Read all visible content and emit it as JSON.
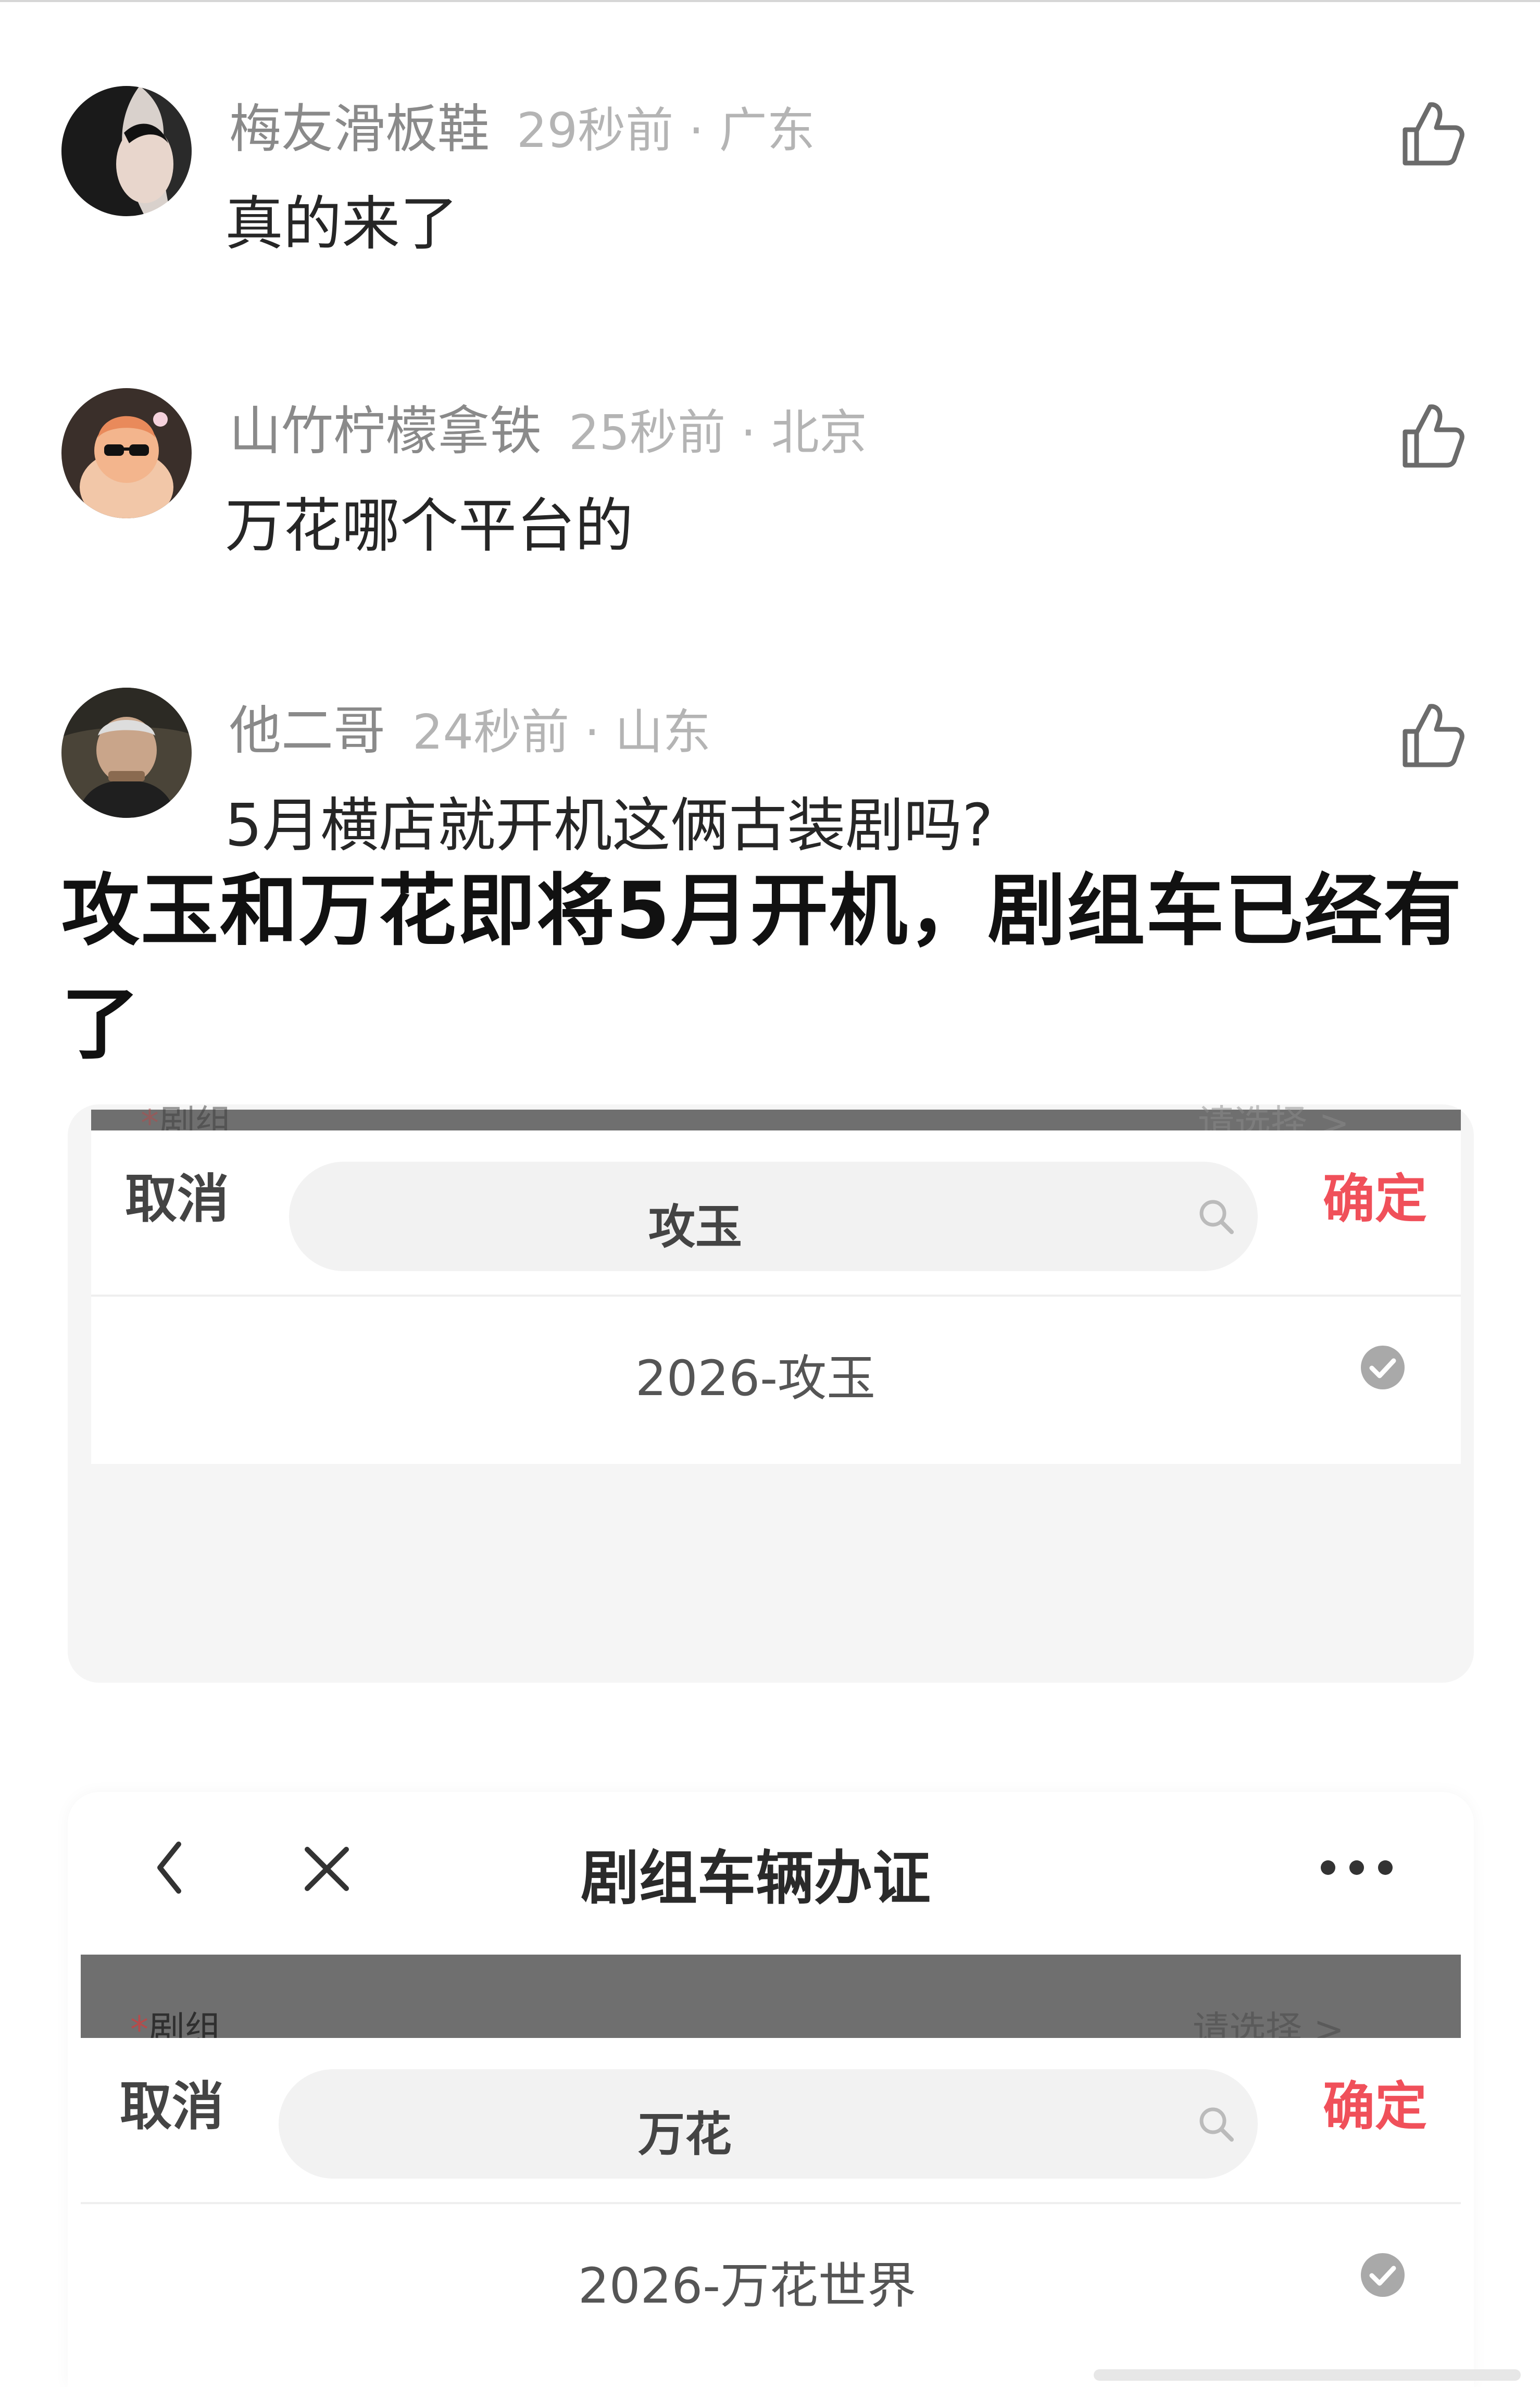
{
  "comments": [
    {
      "name": "梅友滑板鞋",
      "meta": "29秒前 · 广东",
      "text": "真的来了"
    },
    {
      "name": "山竹柠檬拿铁",
      "meta": "25秒前 · 北京",
      "text": "万花哪个平台的"
    },
    {
      "name": "他二哥",
      "meta": "24秒前 · 山东",
      "text": "5月横店就开机这俩古装剧吗?"
    }
  ],
  "headline": "攻玉和万花即将5月开机，剧组车已经有了",
  "card1": {
    "field_label_star": "*",
    "field_label": "剧组",
    "field_right": "请选择 >",
    "cancel": "取消",
    "search_value": "攻玉",
    "confirm": "确定",
    "result": "2026-攻玉"
  },
  "card2": {
    "nav_title": "剧组车辆办证",
    "field_label_star": "*",
    "field_label": "剧组",
    "field_right": "请选择 >",
    "cancel": "取消",
    "search_value": "万花",
    "confirm": "确定",
    "result": "2026-万花世界"
  },
  "icons": {
    "like": "thumbs-up-icon",
    "search": "search-icon",
    "check": "check-circle-icon",
    "back": "chevron-left-icon",
    "close": "close-icon",
    "more": "more-icon"
  },
  "colors": {
    "name_gray": "#8a8a8a",
    "meta_gray": "#b4b4b4",
    "confirm_red": "#f0505a",
    "dim_overlay": "#6f6f6f"
  }
}
